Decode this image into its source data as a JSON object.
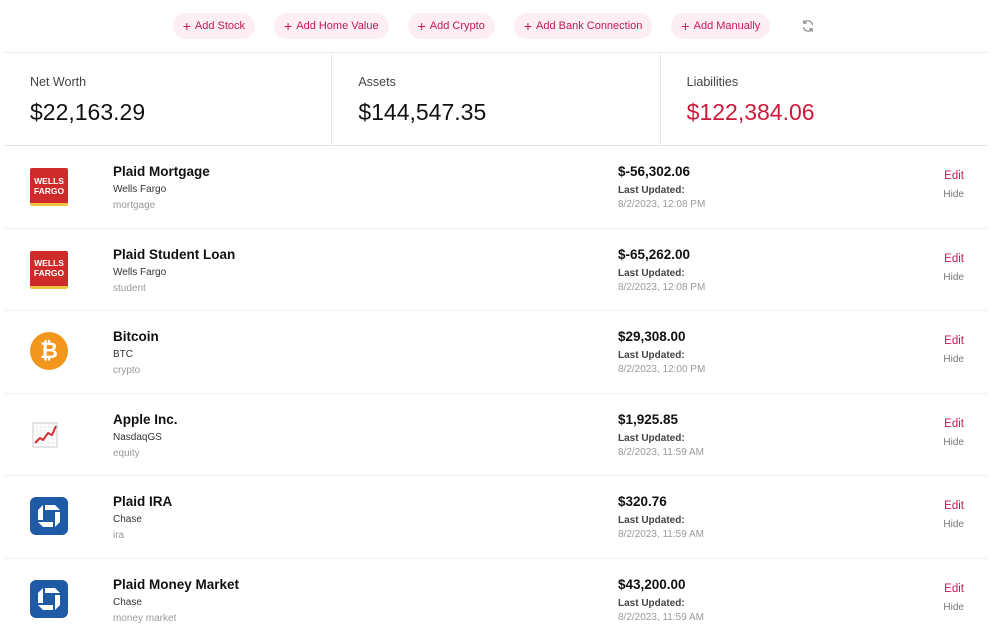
{
  "toolbar": {
    "add_stock": "Add Stock",
    "add_home_value": "Add Home Value",
    "add_crypto": "Add Crypto",
    "add_bank_connection": "Add Bank Connection",
    "add_manually": "Add Manually",
    "refresh_icon": "refresh-icon"
  },
  "summary": {
    "net_worth_label": "Net Worth",
    "net_worth_value": "$22,163.29",
    "assets_label": "Assets",
    "assets_value": "$144,547.35",
    "liabilities_label": "Liabilities",
    "liabilities_value": "$122,384.06"
  },
  "colors": {
    "accent": "#c2185b",
    "pill_bg": "#fdeef3",
    "liability": "#d0183a"
  },
  "accounts": [
    {
      "logo": "wells-fargo-logo",
      "logo_text": [
        "WELLS",
        "FARGO"
      ],
      "name": "Plaid Mortgage",
      "institution": "Wells Fargo",
      "type": "mortgage",
      "amount": "$-56,302.06",
      "updated_label": "Last Updated:",
      "updated": "8/2/2023, 12:08 PM",
      "edit": "Edit",
      "hide": "Hide"
    },
    {
      "logo": "wells-fargo-logo",
      "logo_text": [
        "WELLS",
        "FARGO"
      ],
      "name": "Plaid Student Loan",
      "institution": "Wells Fargo",
      "type": "student",
      "amount": "$-65,262.00",
      "updated_label": "Last Updated:",
      "updated": "8/2/2023, 12:08 PM",
      "edit": "Edit",
      "hide": "Hide"
    },
    {
      "logo": "bitcoin-logo",
      "logo_text": [
        "₿"
      ],
      "name": "Bitcoin",
      "institution": "BTC",
      "type": "crypto",
      "amount": "$29,308.00",
      "updated_label": "Last Updated:",
      "updated": "8/2/2023, 12:00 PM",
      "edit": "Edit",
      "hide": "Hide"
    },
    {
      "logo": "chart-increasing-icon",
      "logo_text": [],
      "name": "Apple Inc.",
      "institution": "NasdaqGS",
      "type": "equity",
      "amount": "$1,925.85",
      "updated_label": "Last Updated:",
      "updated": "8/2/2023, 11:59 AM",
      "edit": "Edit",
      "hide": "Hide"
    },
    {
      "logo": "chase-logo",
      "logo_text": [],
      "name": "Plaid IRA",
      "institution": "Chase",
      "type": "ira",
      "amount": "$320.76",
      "updated_label": "Last Updated:",
      "updated": "8/2/2023, 11:59 AM",
      "edit": "Edit",
      "hide": "Hide"
    },
    {
      "logo": "chase-logo",
      "logo_text": [],
      "name": "Plaid Money Market",
      "institution": "Chase",
      "type": "money market",
      "amount": "$43,200.00",
      "updated_label": "Last Updated:",
      "updated": "8/2/2023, 11:59 AM",
      "edit": "Edit",
      "hide": "Hide"
    }
  ]
}
